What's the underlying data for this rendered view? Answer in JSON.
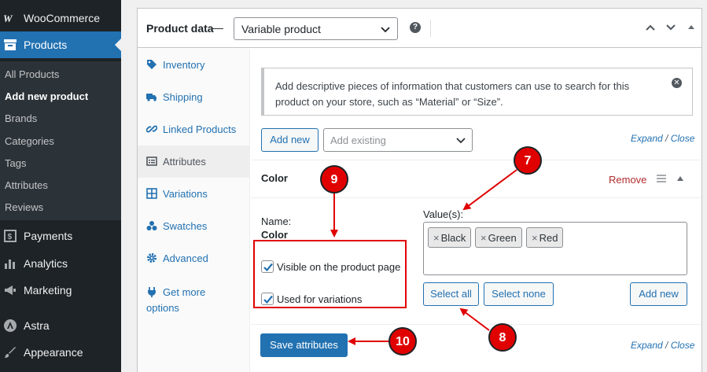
{
  "sidebar": {
    "woocommerce": "WooCommerce",
    "products": "Products",
    "submenu": [
      "All Products",
      "Add new product",
      "Brands",
      "Categories",
      "Tags",
      "Attributes",
      "Reviews"
    ],
    "payments": "Payments",
    "analytics": "Analytics",
    "marketing": "Marketing",
    "astra": "Astra",
    "appearance": "Appearance"
  },
  "header": {
    "title": "Product data —",
    "product_type": "Variable product",
    "help": "?"
  },
  "tabs": [
    "Inventory",
    "Shipping",
    "Linked Products",
    "Attributes",
    "Variations",
    "Swatches",
    "Advanced",
    "Get more options"
  ],
  "tabs_extra": {
    "get_more_line1": "Get more",
    "get_more_line2": "options"
  },
  "notice": {
    "text": "Add descriptive pieces of information that customers can use to search for this product on your store, such as “Material” or “Size”."
  },
  "toolbar": {
    "add_new": "Add new",
    "add_existing_placeholder": "Add existing",
    "expand": "Expand",
    "slash": " / ",
    "close": "Close"
  },
  "attribute": {
    "name": "Color",
    "remove": "Remove",
    "name_label": "Name:",
    "name_value": "Color",
    "values_label": "Value(s):",
    "values": [
      "Black",
      "Green",
      "Red"
    ],
    "visible_label": "Visible on the product page",
    "variations_label": "Used for variations",
    "visible_checked": true,
    "variations_checked": true,
    "select_all": "Select all",
    "select_none": "Select none",
    "add_new": "Add new"
  },
  "footer": {
    "save": "Save attributes"
  },
  "callouts": [
    "7",
    "8",
    "9",
    "10"
  ],
  "colors": {
    "accent": "#2271b1",
    "callout": "#e00000",
    "sidebar": "#1d2327"
  }
}
